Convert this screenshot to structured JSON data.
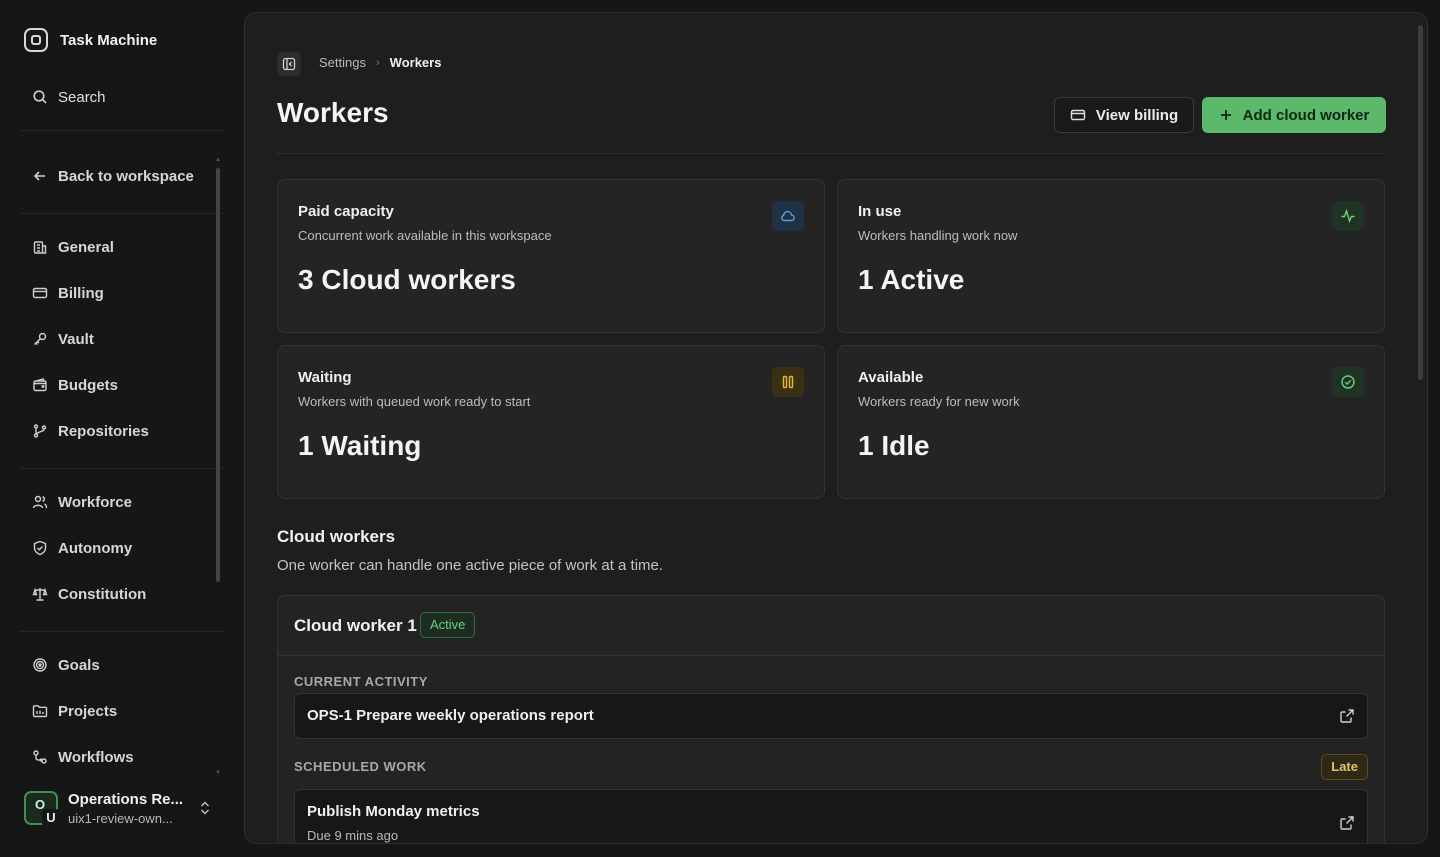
{
  "app": {
    "name": "Task Machine"
  },
  "sidebar": {
    "search_label": "Search",
    "back_label": "Back to workspace",
    "groups": [
      [
        {
          "label": "General",
          "icon": "building-icon"
        },
        {
          "label": "Billing",
          "icon": "credit-card-icon"
        },
        {
          "label": "Vault",
          "icon": "key-icon"
        },
        {
          "label": "Budgets",
          "icon": "wallet-icon"
        },
        {
          "label": "Repositories",
          "icon": "git-branch-icon"
        }
      ],
      [
        {
          "label": "Workforce",
          "icon": "users-icon"
        },
        {
          "label": "Autonomy",
          "icon": "shield-icon"
        },
        {
          "label": "Constitution",
          "icon": "scale-icon"
        }
      ],
      [
        {
          "label": "Goals",
          "icon": "target-icon"
        },
        {
          "label": "Projects",
          "icon": "folder-icon"
        },
        {
          "label": "Workflows",
          "icon": "workflow-icon"
        }
      ]
    ],
    "account": {
      "name": "Operations Re...",
      "sub": "uix1-review-own...",
      "avatar_primary": "O",
      "avatar_secondary": "U"
    }
  },
  "breadcrumb": {
    "parent": "Settings",
    "current": "Workers"
  },
  "page": {
    "title": "Workers",
    "view_billing_label": "View billing",
    "add_worker_label": "Add cloud worker"
  },
  "stats": [
    {
      "title": "Paid capacity",
      "desc": "Concurrent work available in this workspace",
      "value": "3 Cloud workers",
      "icon": "cloud-icon",
      "color": "#5aa0d8"
    },
    {
      "title": "In use",
      "desc": "Workers handling work now",
      "value": "1 Active",
      "icon": "activity-icon",
      "color": "#5cb86a"
    },
    {
      "title": "Waiting",
      "desc": "Workers with queued work ready to start",
      "value": "1 Waiting",
      "icon": "pause-icon",
      "color": "#e2b43c"
    },
    {
      "title": "Available",
      "desc": "Workers ready for new work",
      "value": "1 Idle",
      "icon": "check-circle-icon",
      "color": "#5cb86a"
    }
  ],
  "cloud_workers": {
    "title": "Cloud workers",
    "desc": "One worker can handle one active piece of work at a time.",
    "workers": [
      {
        "name": "Cloud worker 1",
        "status": "Active",
        "current_activity_label": "CURRENT ACTIVITY",
        "current_activity": "OPS-1 Prepare weekly operations report",
        "scheduled_label": "SCHEDULED WORK",
        "scheduled_badge": "Late",
        "scheduled": {
          "title": "Publish Monday metrics",
          "sub": "Due 9 mins ago"
        }
      }
    ]
  },
  "colors": {
    "accent": "#5cb86a",
    "background": "#161616",
    "panel": "#1e1e1e",
    "card": "#242424"
  }
}
